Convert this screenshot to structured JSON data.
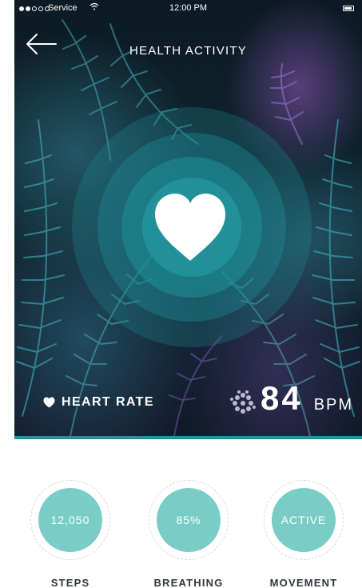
{
  "status_bar": {
    "carrier": "Service",
    "time": "12:00 PM"
  },
  "header": {
    "title": "HEALTH ACTIVITY"
  },
  "heart_rate": {
    "label": "HEART RATE",
    "value": "84",
    "unit": "BPM"
  },
  "stats": [
    {
      "value": "12,050",
      "label": "STEPS"
    },
    {
      "value": "85%",
      "label": "BREATHING"
    },
    {
      "value": "ACTIVE",
      "label": "MOVEMENT"
    }
  ],
  "colors": {
    "accent": "#79cdc6",
    "pulse": "#1f8f98",
    "label_text": "#2f3640"
  },
  "icons": [
    "back-arrow-icon",
    "heart-icon",
    "wifi-icon",
    "battery-icon"
  ]
}
